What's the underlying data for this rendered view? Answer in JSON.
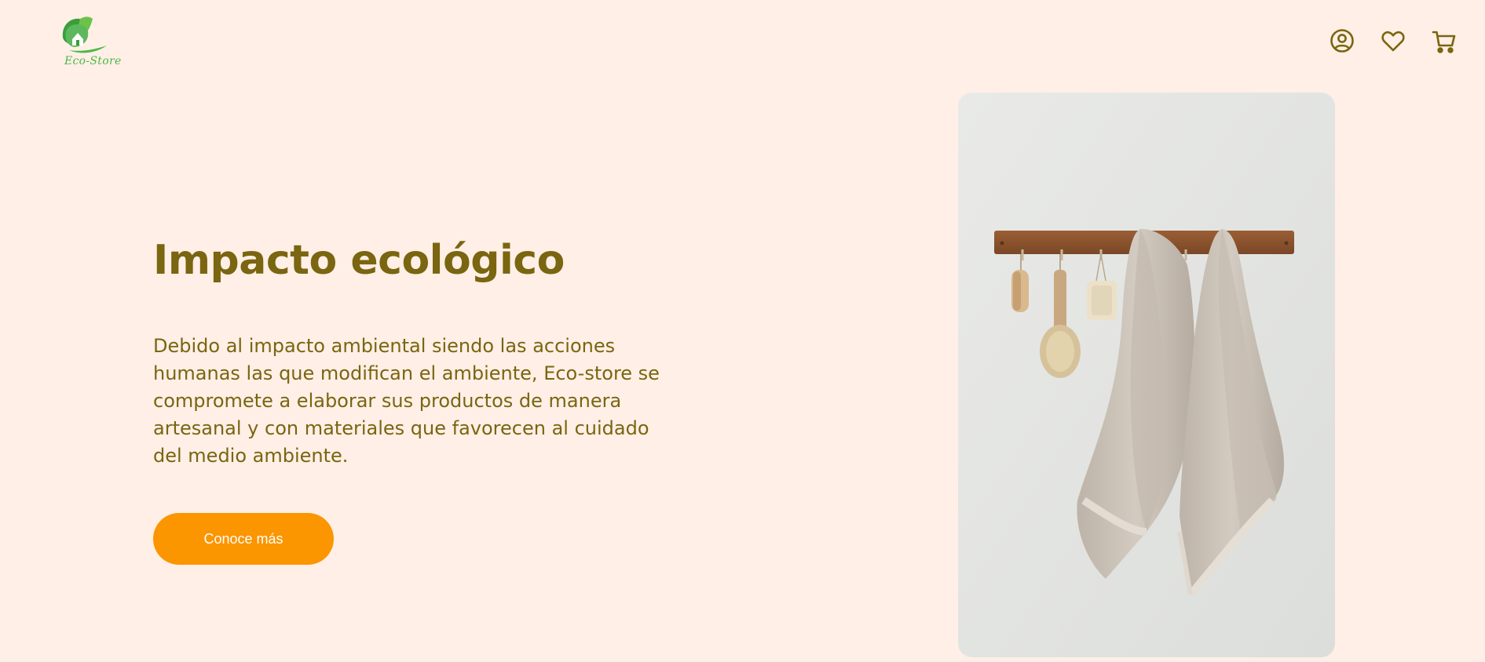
{
  "header": {
    "logo_text": "Eco-Store",
    "icons": [
      {
        "name": "user-account-icon"
      },
      {
        "name": "heart-favorites-icon"
      },
      {
        "name": "shopping-cart-icon"
      }
    ]
  },
  "hero": {
    "title": "Impacto ecológico",
    "description": "Debido al impacto ambiental siendo las acciones humanas las que modifican el ambiente, Eco-store se compromete a elaborar sus productos de manera artesanal y con materiales que favorecen al cuidado del medio ambiente.",
    "cta_label": "Conoce más"
  },
  "colors": {
    "background": "#ffefe6",
    "text_primary": "#7a6510",
    "accent": "#fb9500",
    "logo_green": "#4db848"
  }
}
